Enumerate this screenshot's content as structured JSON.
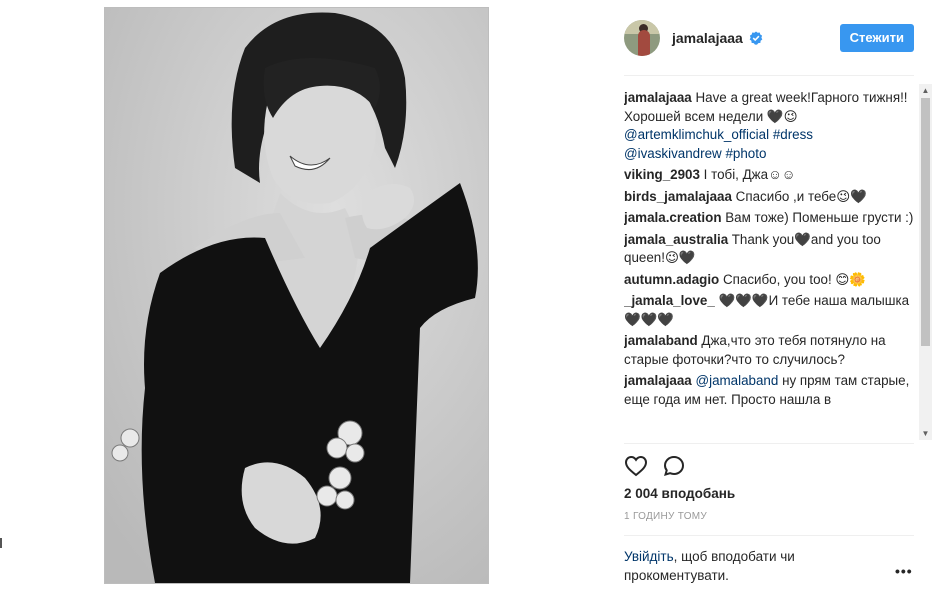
{
  "post": {
    "username": "jamalajaaa",
    "follow_label": "Стежити",
    "likes": "2 004 вподобань",
    "time": "1 ГОДИНУ ТОМУ",
    "login_link": "Увійдіть",
    "login_rest": ", щоб вподобати чи прокоментувати.",
    "more": "•••"
  },
  "comments": [
    {
      "author": "jamalajaaa",
      "parts": [
        {
          "text": " Have a great week!Гарного тижня!! Хорошей всем недели 🖤😉 "
        },
        {
          "text": "@artemklimchuk_official",
          "link": true
        },
        {
          "text": " "
        },
        {
          "text": "#dress",
          "link": true
        },
        {
          "text": " "
        },
        {
          "text": "@ivaskivandrew",
          "link": true
        },
        {
          "text": " "
        },
        {
          "text": "#photo",
          "link": true
        }
      ]
    },
    {
      "author": "viking_2903",
      "parts": [
        {
          "text": " І тобі, Джа☺☺"
        }
      ]
    },
    {
      "author": "birds_jamalajaaa",
      "parts": [
        {
          "text": " Спасибо ,и тебе😉🖤"
        }
      ]
    },
    {
      "author": "jamala.creation",
      "parts": [
        {
          "text": " Вам тоже) Поменьше грусти :)"
        }
      ]
    },
    {
      "author": "jamala_australia",
      "parts": [
        {
          "text": " Thank you🖤and you too queen!😉🖤"
        }
      ]
    },
    {
      "author": "autumn.adagio",
      "parts": [
        {
          "text": " Спасибо, you too! 😊🌼"
        }
      ]
    },
    {
      "author": "_jamala_love_",
      "parts": [
        {
          "text": " 🖤🖤🖤И тебе наша малышка🖤🖤🖤"
        }
      ]
    },
    {
      "author": "jamalaband",
      "parts": [
        {
          "text": " Джа,что это тебя потянуло на старые фоточки?что то случилось?"
        }
      ]
    },
    {
      "author": "jamalajaaa",
      "parts": [
        {
          "text": " "
        },
        {
          "text": "@jamalaband",
          "link": true
        },
        {
          "text": " ну прям там старые, еще года им нет. Просто нашла в"
        }
      ]
    }
  ],
  "icons": {
    "verified": "verified-badge-icon",
    "like": "heart-icon",
    "comment": "comment-bubble-icon",
    "more": "more-options-icon"
  },
  "colors": {
    "follow_button": "#3897f0",
    "link": "#003569",
    "verified": "#3897f0"
  }
}
